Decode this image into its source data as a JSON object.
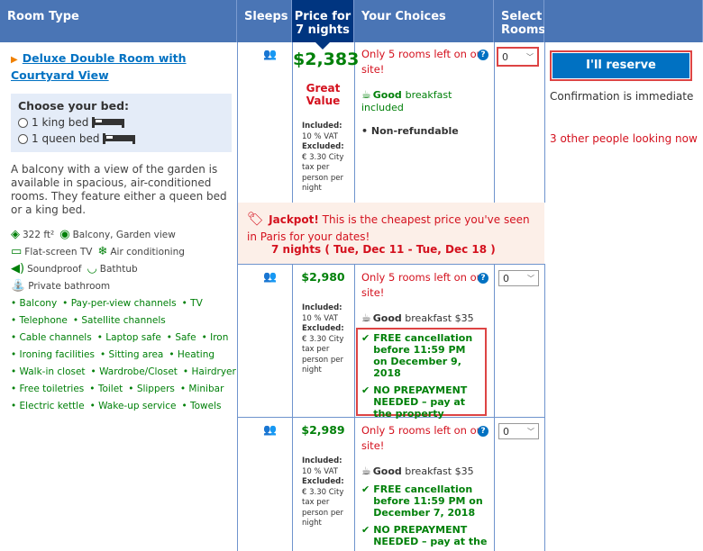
{
  "header": {
    "room_type": "Room Type",
    "sleeps": "Sleeps",
    "price_line1": "Price for",
    "price_line2": "7 nights",
    "choices": "Your Choices",
    "select_line1": "Select",
    "select_line2": "Rooms"
  },
  "room": {
    "name": "Deluxe Double Room with Courtyard View",
    "choose_bed": "Choose your bed:",
    "bed_options": [
      "1 king bed",
      "1 queen bed"
    ],
    "description": "A balcony with a view of the garden is available in spacious, air-conditioned rooms. They feature either a queen bed or a king bed.",
    "facilities": {
      "size": "322 ft²",
      "balcony_view": "Balcony, Garden view",
      "tv": "Flat-screen TV",
      "ac": "Air conditioning",
      "soundproof": "Soundproof",
      "bathtub": "Bathtub",
      "bathroom": "Private bathroom"
    },
    "amenities": [
      [
        "Balcony",
        "Pay-per-view channels",
        "TV"
      ],
      [
        "Telephone",
        "Satellite channels"
      ],
      [
        "Cable channels",
        "Laptop safe",
        "Safe",
        "Iron"
      ],
      [
        "Ironing facilities",
        "Sitting area",
        "Heating"
      ],
      [
        "Walk-in closet",
        "Wardrobe/Closet",
        "Hairdryer"
      ],
      [
        "Free toiletries",
        "Toilet",
        "Slippers",
        "Minibar"
      ],
      [
        "Electric kettle",
        "Wake-up service",
        "Towels"
      ]
    ]
  },
  "offers": [
    {
      "price": "$2,383",
      "badge": "Great Value",
      "tax_included": "Included:",
      "tax_included_val": "10 % VAT",
      "tax_excluded": "Excluded:",
      "tax_excluded_val": "€ 3.30 City tax per person per night",
      "rooms_left": "Only 5 rooms left on our site!",
      "breakfast_bold": "Good",
      "breakfast_rest": "breakfast included",
      "policy": "Non-refundable",
      "select_value": "0"
    },
    {
      "price": "$2,980",
      "tax_included": "Included:",
      "tax_included_val": "10 % VAT",
      "tax_excluded": "Excluded:",
      "tax_excluded_val": "€ 3.30 City tax per person per night",
      "rooms_left": "Only 5 rooms left on our site!",
      "breakfast_bold": "Good",
      "breakfast_rest": "breakfast $35",
      "cancel": "FREE cancellation before 11:59 PM on December 9, 2018",
      "prepay": "NO PREPAYMENT NEEDED – pay at the property",
      "select_value": "0"
    },
    {
      "price": "$2,989",
      "tax_included": "Included:",
      "tax_included_val": "10 % VAT",
      "tax_excluded": "Excluded:",
      "tax_excluded_val": "€ 3.30 City tax per person per night",
      "rooms_left": "Only 5 rooms left on our site!",
      "breakfast_bold": "Good",
      "breakfast_rest": "breakfast $35",
      "cancel": "FREE cancellation before 11:59 PM on December 7, 2018",
      "prepay": "NO PREPAYMENT NEEDED – pay at the",
      "select_value": "0"
    }
  ],
  "jackpot": {
    "title": "Jackpot!",
    "text": "This is the cheapest price you've seen in Paris for your dates!",
    "dates": "7 nights ( Tue, Dec 11 - Tue, Dec 18 )"
  },
  "reserve": {
    "button": "I'll reserve",
    "confirmation": "Confirmation is immediate",
    "looking": "3 other people looking now"
  },
  "colors": {
    "header_blue": "#4a75b5",
    "price_header": "#003580",
    "green": "#008009",
    "red": "#d4111e",
    "link_blue": "#0071c2"
  }
}
